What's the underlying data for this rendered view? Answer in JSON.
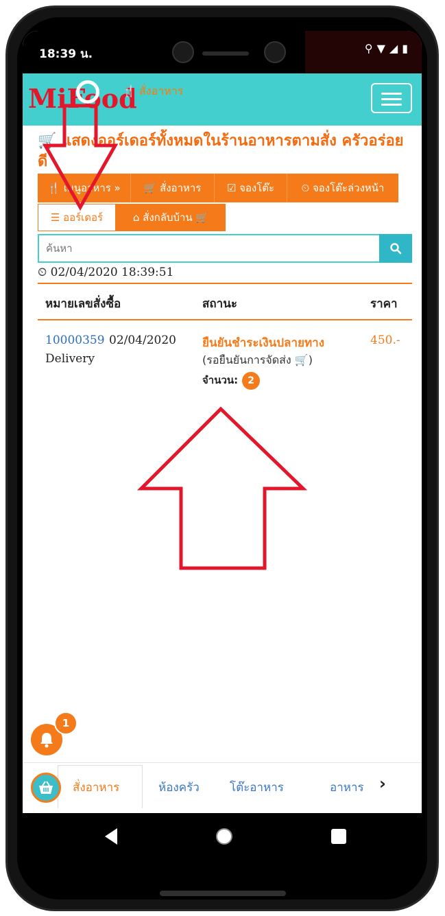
{
  "status_bar": {
    "time": "18:39 น.",
    "icons": [
      "location-icon",
      "wifi-icon",
      "signal-icon",
      "battery-icon"
    ]
  },
  "navbar": {
    "brand": "MiFood",
    "link": "สั่งอาหาร",
    "brand_color": "#e2172b",
    "bar_color": "#44cfcf"
  },
  "page": {
    "title": "แสดงออร์เดอร์ทั้งหมดในร้านอาหารตามสั่ง ครัวอร่อยดี"
  },
  "menu_tabs": [
    {
      "label": "เมนูอาหาร »",
      "icon": "cutlery-icon"
    },
    {
      "label": "สั่งอาหาร",
      "icon": "cart-icon"
    },
    {
      "label": "จองโต๊ะ",
      "icon": "check-square-icon"
    },
    {
      "label": "จองโต๊ะล่วงหน้า",
      "icon": "clock-icon"
    }
  ],
  "sub_tabs": [
    {
      "label": "ออร์เดอร์",
      "icon": "list-icon",
      "active": true
    },
    {
      "label": "สั่งกลับบ้าน",
      "icon": "home-icon",
      "active": false
    }
  ],
  "search": {
    "placeholder": "ค้นหา",
    "value": ""
  },
  "datetime": "02/04/2020 18:39:51",
  "table": {
    "headers": [
      "หมายเลขสั่งซื้อ",
      "สถานะ",
      "ราคา"
    ],
    "rows": [
      {
        "order_id": "10000359",
        "date": "02/04/2020",
        "type": "Delivery",
        "status": "ยืนยันชำระเงินปลายทาง",
        "status_sub": "(รอยืนยันการจัดส่ง",
        "qty_label": "จำนวน:",
        "qty": "2",
        "price": "450.-"
      }
    ]
  },
  "notifications": {
    "count": "1"
  },
  "bottom_nav": [
    {
      "label": "สั่งอาหาร",
      "active": true
    },
    {
      "label": "ห้องครัว",
      "active": false
    },
    {
      "label": "โต๊ะอาหาร",
      "active": false
    },
    {
      "label": "อาหาร",
      "active": false
    }
  ],
  "colors": {
    "accent": "#f57b1a",
    "link": "#2d6fb8",
    "annotation": "#e2172b"
  }
}
